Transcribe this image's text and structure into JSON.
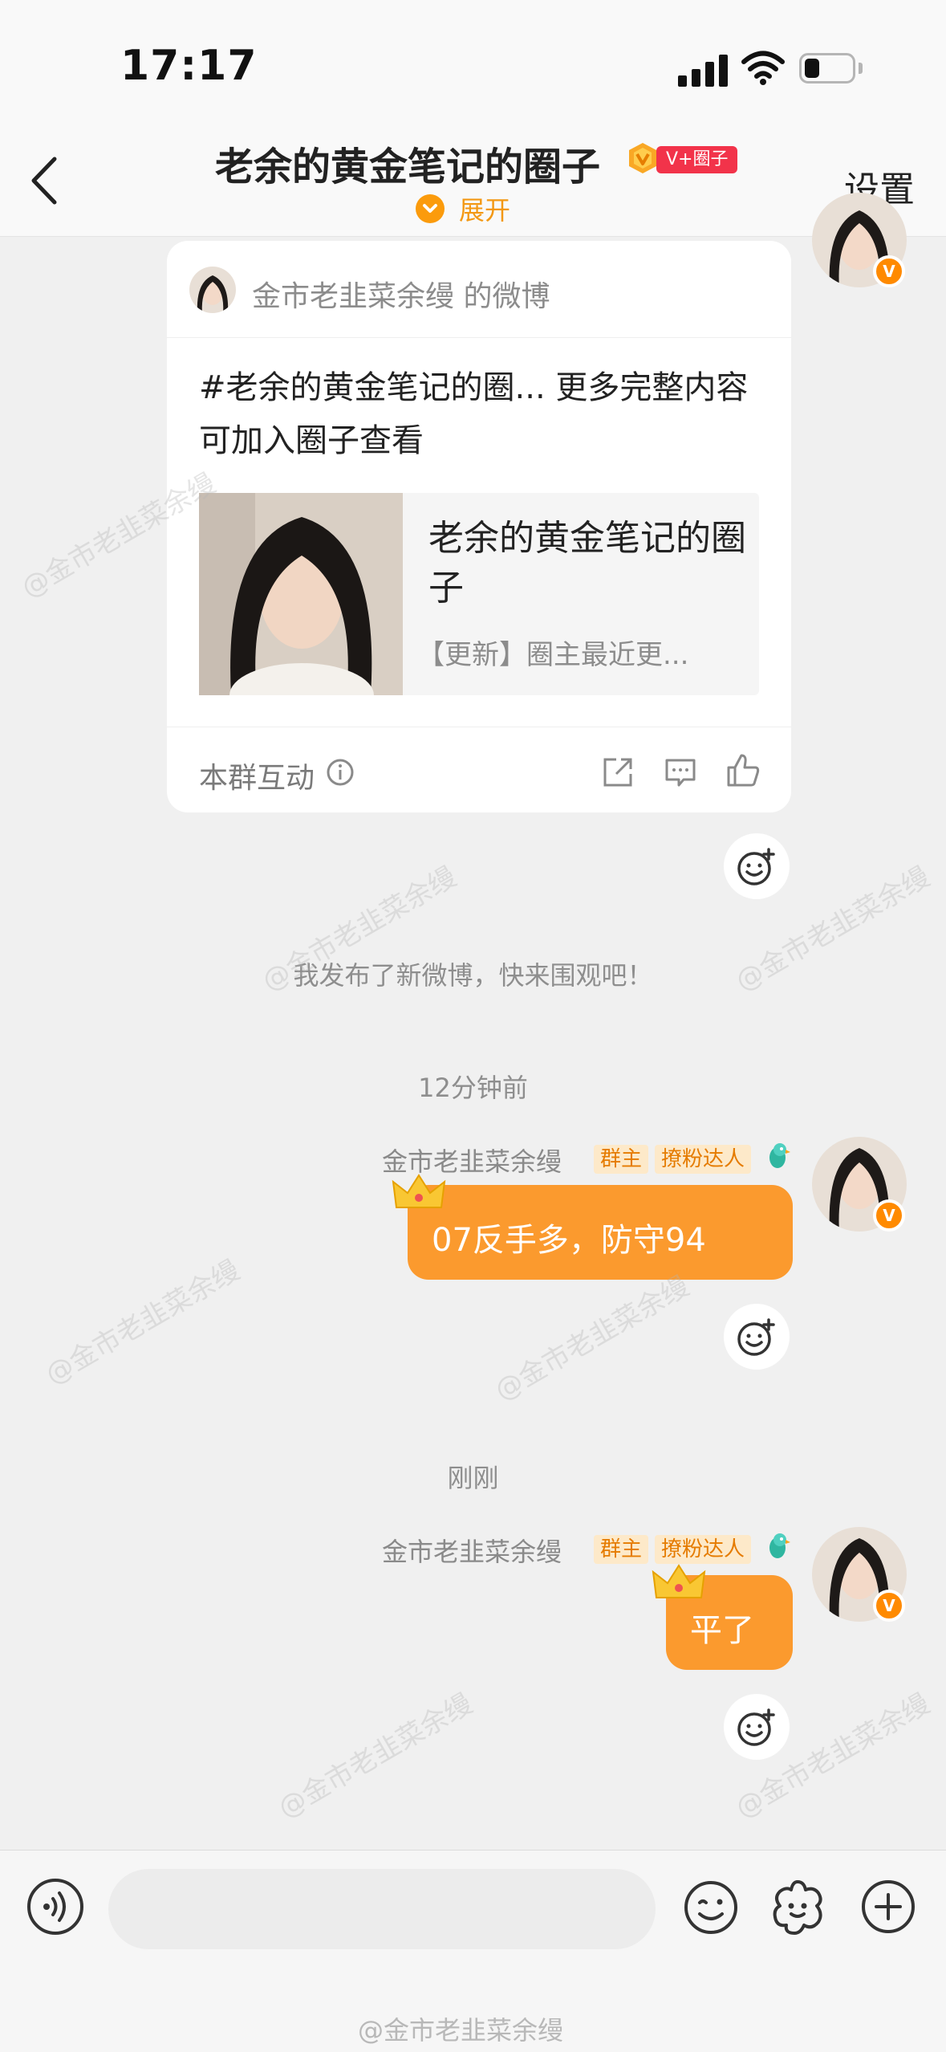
{
  "status_bar": {
    "time": "17:17"
  },
  "header": {
    "title": "老余的黄金笔记的圈子",
    "badge": "V+圈子",
    "expand_label": "展开",
    "settings_label": "设置"
  },
  "weibo_card": {
    "source": "金市老韭菜余缦 的微博",
    "text": "#老余的黄金笔记的圈... 更多完整内容可加入圈子查看",
    "link_title": "老余的黄金笔记的圈子",
    "link_subtitle": "【更新】圈主最近更...",
    "interact_label": "本群互动"
  },
  "system_message": "我发布了新微博，快来围观吧！",
  "messages": [
    {
      "time": "12分钟前",
      "sender": "金市老韭菜余缦",
      "tag_owner": "群主",
      "tag_fan": "撩粉达人",
      "text": "07反手多，防守94"
    },
    {
      "time": "刚刚",
      "sender": "金市老韭菜余缦",
      "tag_owner": "群主",
      "tag_fan": "撩粉达人",
      "text": "平了"
    }
  ],
  "input": {
    "placeholder": ""
  },
  "watermark": "@金市老韭菜余缦",
  "bottom_watermark": "@金市老韭菜余缦",
  "colors": {
    "accent": "#fb9a2e",
    "badge_red": "#f2334a",
    "background": "#f0f0f0"
  }
}
